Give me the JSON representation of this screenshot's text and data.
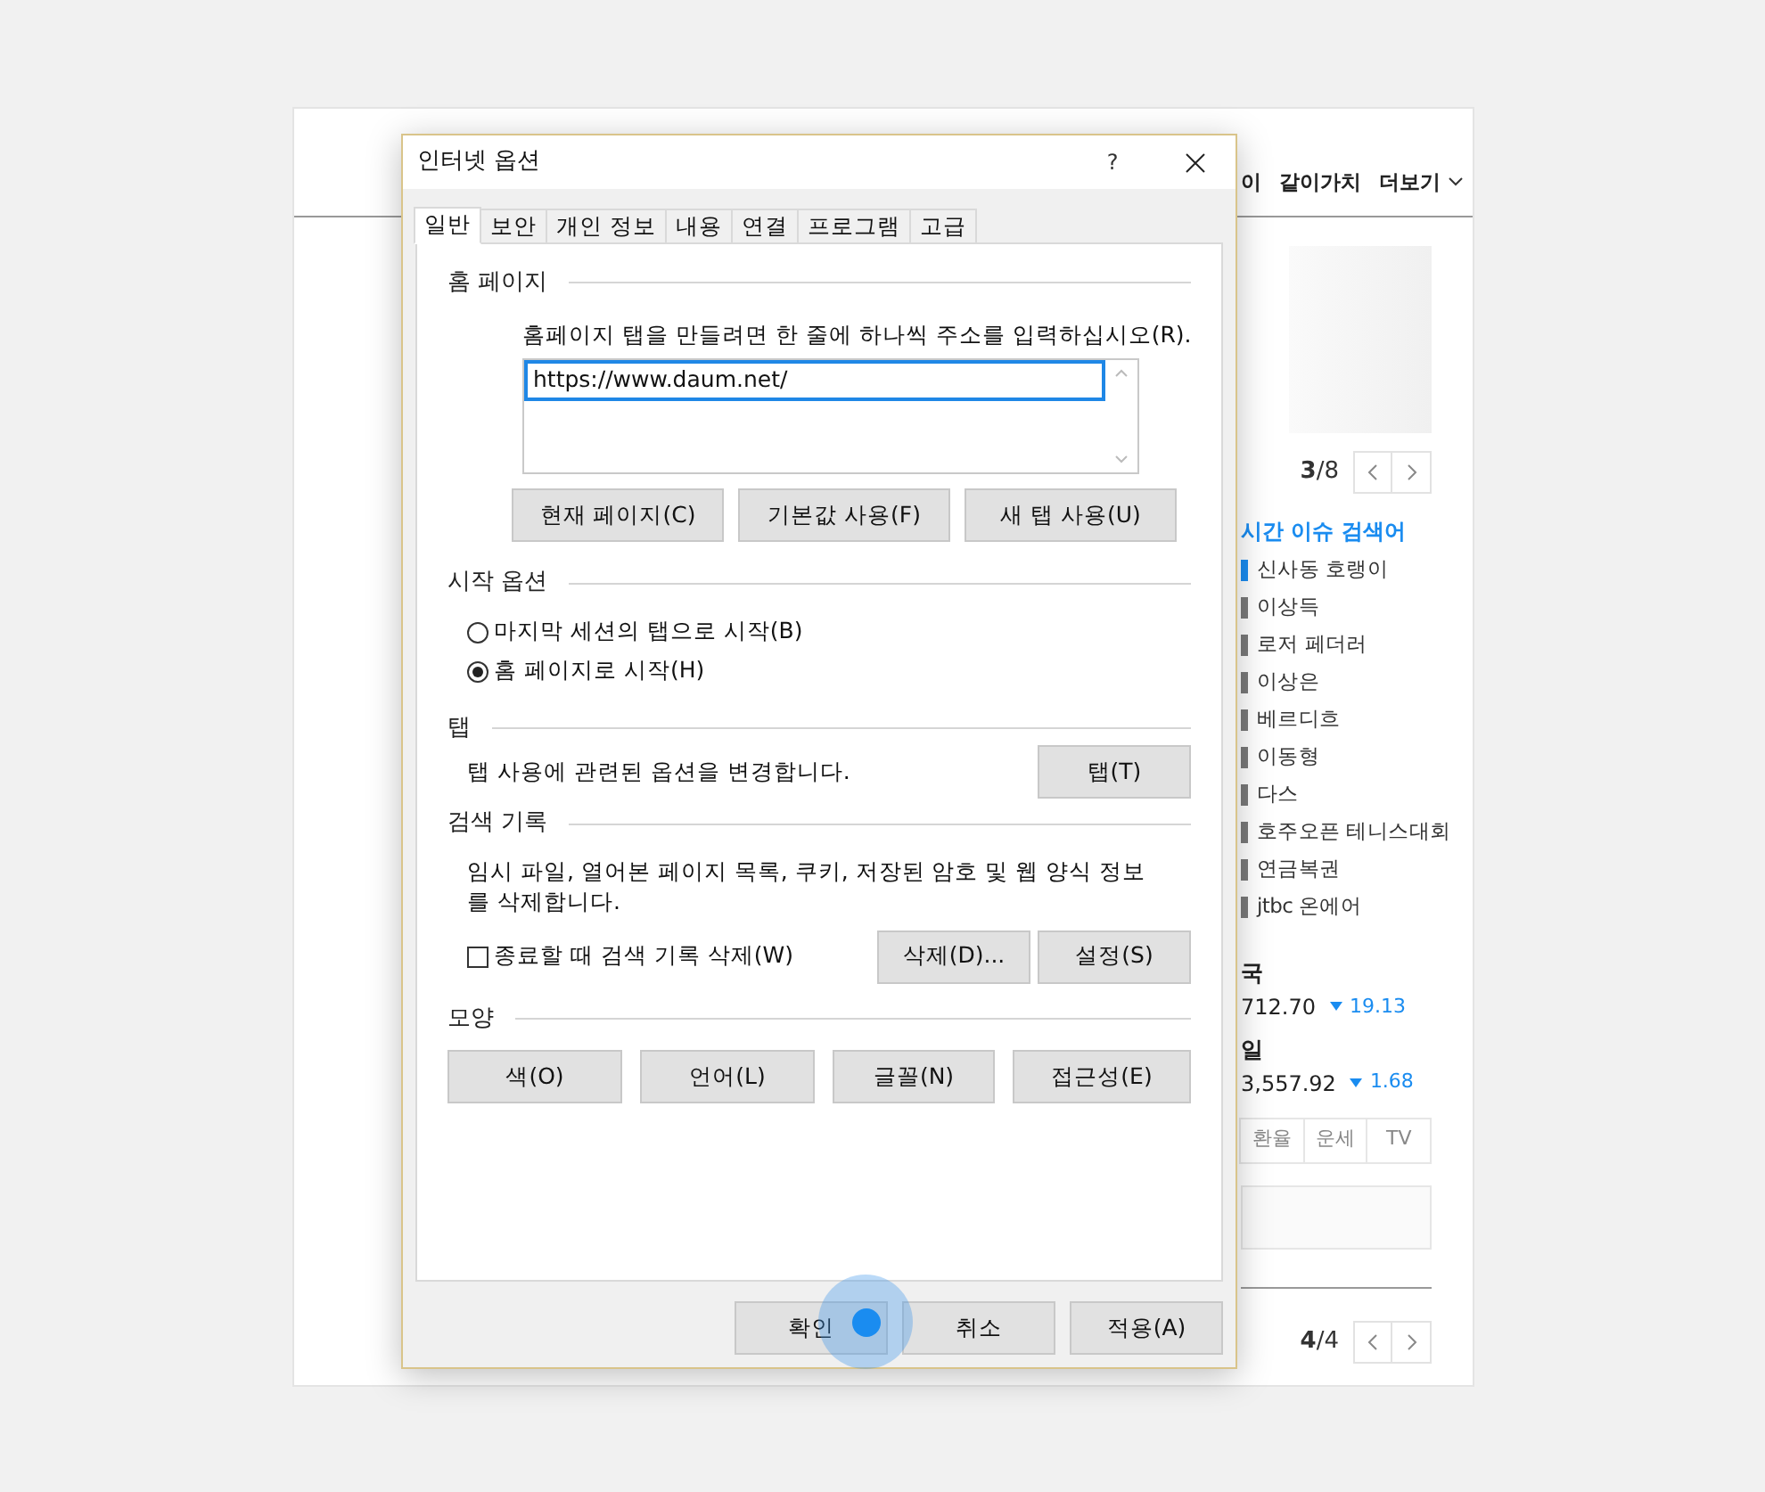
{
  "page": {
    "nav": [
      "이",
      "같이가치",
      "더보기"
    ],
    "banner_pager": {
      "current": "3",
      "total": "/8"
    },
    "trending_title": "시간 이슈 검색어",
    "trending": [
      {
        "label": "신사동 호랭이",
        "selected": true
      },
      {
        "label": "이상득",
        "selected": false
      },
      {
        "label": "로저 페더러",
        "selected": false
      },
      {
        "label": "이상은",
        "selected": false
      },
      {
        "label": "베르디흐",
        "selected": false
      },
      {
        "label": "이동형",
        "selected": false
      },
      {
        "label": "다스",
        "selected": false
      },
      {
        "label": "호주오픈 테니스대회",
        "selected": false
      },
      {
        "label": "연금복권",
        "selected": false
      },
      {
        "label": "jtbc 온에어",
        "selected": false
      }
    ],
    "markets": [
      {
        "name": "국",
        "value": "712.70",
        "change": "19.13"
      },
      {
        "name": "일",
        "value": "3,557.92",
        "change": "1.68"
      }
    ],
    "info_tabs": [
      "환율",
      "운세",
      "TV"
    ],
    "bottom_pager": {
      "current": "4",
      "total": "/4"
    }
  },
  "dialog": {
    "title": "인터넷 옵션",
    "help": "?",
    "tabs": [
      {
        "label": "일반",
        "selected": true
      },
      {
        "label": "보안",
        "selected": false
      },
      {
        "label": "개인 정보",
        "selected": false
      },
      {
        "label": "내용",
        "selected": false
      },
      {
        "label": "연결",
        "selected": false
      },
      {
        "label": "프로그램",
        "selected": false
      },
      {
        "label": "고급",
        "selected": false
      }
    ],
    "home_page": {
      "title": "홈 페이지",
      "instruction": "홈페이지 탭을 만들려면 한 줄에 하나씩 주소를 입력하십시오(R).",
      "value": "https://www.daum.net/",
      "buttons": [
        "현재 페이지(C)",
        "기본값 사용(F)",
        "새 탭 사용(U)"
      ]
    },
    "startup": {
      "title": "시작 옵션",
      "options": [
        {
          "label": "마지막 세션의 탭으로 시작(B)",
          "selected": false
        },
        {
          "label": "홈 페이지로 시작(H)",
          "selected": true
        }
      ]
    },
    "tabs_section": {
      "title": "탭",
      "description": "탭 사용에 관련된 옵션을 변경합니다.",
      "button": "탭(T)"
    },
    "history": {
      "title": "검색 기록",
      "description": "임시 파일, 열어본 페이지 목록, 쿠키, 저장된 암호 및 웹 양식 정보를 삭제합니다.",
      "checkbox": {
        "label": "종료할 때 검색 기록 삭제(W)",
        "checked": false
      },
      "buttons": [
        "삭제(D)...",
        "설정(S)"
      ]
    },
    "appearance": {
      "title": "모양",
      "buttons": [
        "색(O)",
        "언어(L)",
        "글꼴(N)",
        "접근성(E)"
      ]
    },
    "footer_buttons": [
      "확인",
      "취소",
      "적용(A)"
    ]
  }
}
